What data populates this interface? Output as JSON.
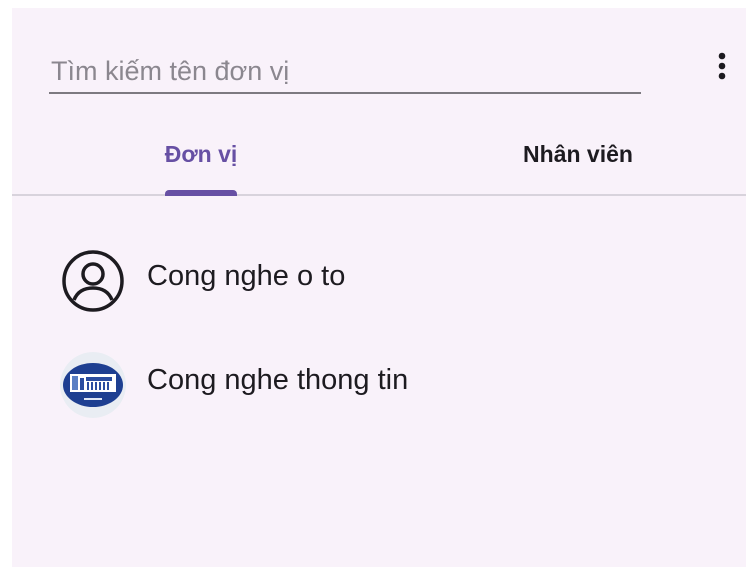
{
  "search": {
    "placeholder": "Tìm kiếm tên đơn vị",
    "value": ""
  },
  "menu": {
    "icon": "more-vert-icon"
  },
  "tabs": [
    {
      "label": "Đơn vị",
      "selected": true
    },
    {
      "label": "Nhân viên",
      "selected": false
    }
  ],
  "list": {
    "items": [
      {
        "label": "Cong nghe o to",
        "icon": "person-circle-icon"
      },
      {
        "label": "Cong nghe thong tin",
        "icon": "building-logo-icon"
      }
    ]
  },
  "colors": {
    "background": "#f9f2fa",
    "accent": "#6750a4",
    "text": "#1d1b20",
    "divider": "#d8d3dc"
  }
}
